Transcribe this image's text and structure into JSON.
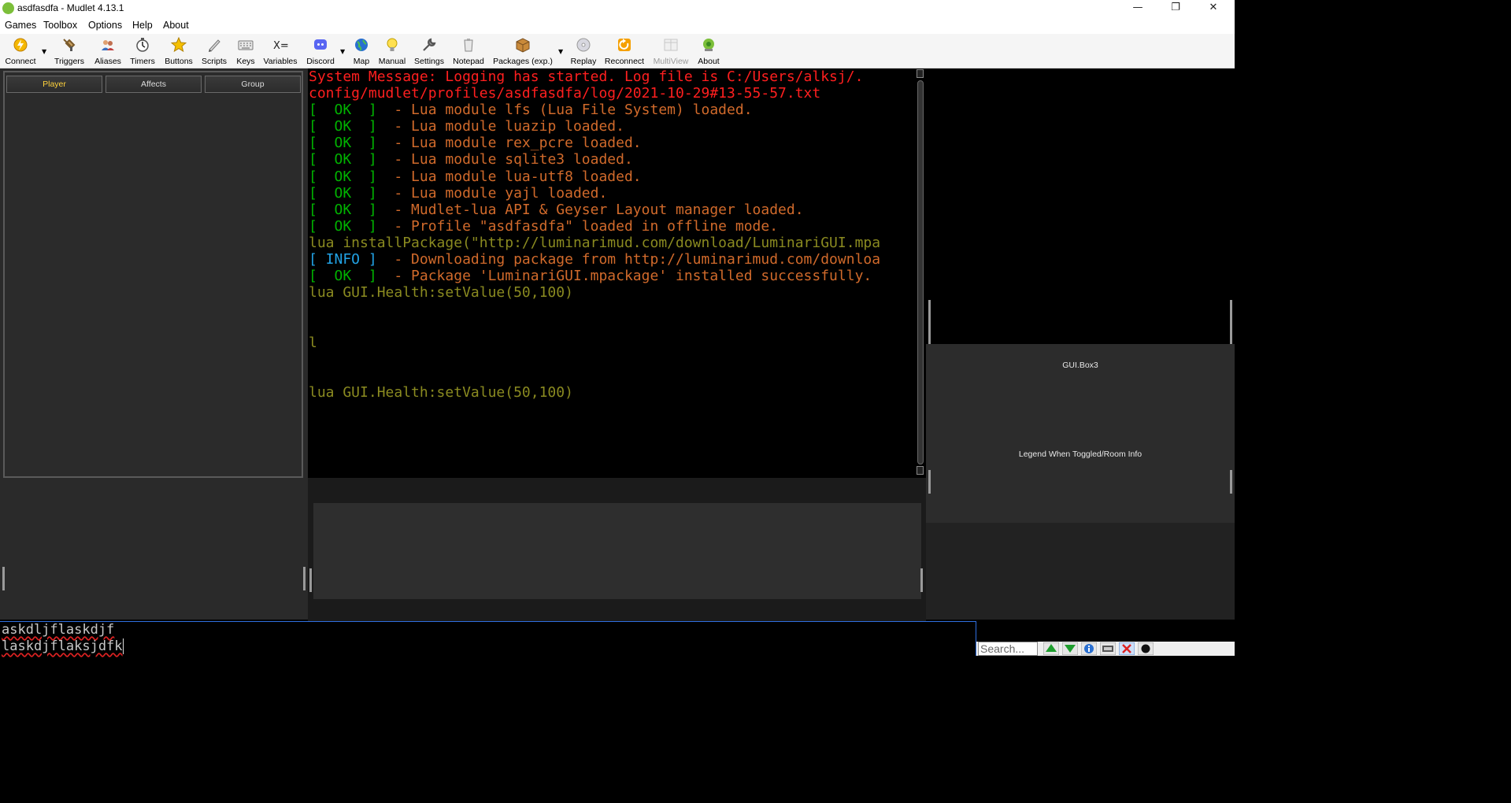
{
  "window": {
    "title": "asdfasdfa - Mudlet 4.13.1",
    "minimize_glyph": "—",
    "restore_glyph": "❐",
    "close_glyph": "✕"
  },
  "menu": [
    "Games",
    "Toolbox",
    "Options",
    "Help",
    "About"
  ],
  "toolbar": [
    {
      "label": "Connect",
      "icon": "connect-icon",
      "dropdown": true
    },
    {
      "label": "Triggers",
      "icon": "triggers-icon"
    },
    {
      "label": "Aliases",
      "icon": "aliases-icon"
    },
    {
      "label": "Timers",
      "icon": "timers-icon"
    },
    {
      "label": "Buttons",
      "icon": "buttons-icon"
    },
    {
      "label": "Scripts",
      "icon": "scripts-icon"
    },
    {
      "label": "Keys",
      "icon": "keys-icon"
    },
    {
      "label": "Variables",
      "icon": "variables-icon"
    },
    {
      "label": "Discord",
      "icon": "discord-icon",
      "dropdown": true
    },
    {
      "label": "Map",
      "icon": "map-icon"
    },
    {
      "label": "Manual",
      "icon": "manual-icon"
    },
    {
      "label": "Settings",
      "icon": "settings-icon"
    },
    {
      "label": "Notepad",
      "icon": "notepad-icon"
    },
    {
      "label": "Packages (exp.)",
      "icon": "packages-icon",
      "dropdown": true
    },
    {
      "label": "Replay",
      "icon": "replay-icon"
    },
    {
      "label": "Reconnect",
      "icon": "reconnect-icon"
    },
    {
      "label": "MultiView",
      "icon": "multiview-icon",
      "disabled": true
    },
    {
      "label": "About",
      "icon": "about-icon"
    }
  ],
  "left_tabs": [
    {
      "label": "Player",
      "active": true
    },
    {
      "label": "Affects",
      "active": false
    },
    {
      "label": "Group",
      "active": false
    }
  ],
  "console_lines": [
    [
      {
        "t": "System Message: Logging has started. Log file is C:/Users/alksj/.",
        "c": "red"
      }
    ],
    [
      {
        "t": "config/mudlet/profiles/asdfasdfa/log/2021-10-29#13-55-57.txt",
        "c": "red"
      }
    ],
    [
      {
        "t": "[  OK  ]",
        "c": "green"
      },
      {
        "t": "  - Lua module lfs (Lua File System) loaded.",
        "c": "orange"
      }
    ],
    [
      {
        "t": "[  OK  ]",
        "c": "green"
      },
      {
        "t": "  - Lua module luazip loaded.",
        "c": "orange"
      }
    ],
    [
      {
        "t": "[  OK  ]",
        "c": "green"
      },
      {
        "t": "  - Lua module rex_pcre loaded.",
        "c": "orange"
      }
    ],
    [
      {
        "t": "[  OK  ]",
        "c": "green"
      },
      {
        "t": "  - Lua module sqlite3 loaded.",
        "c": "orange"
      }
    ],
    [
      {
        "t": "[  OK  ]",
        "c": "green"
      },
      {
        "t": "  - Lua module lua-utf8 loaded.",
        "c": "orange"
      }
    ],
    [
      {
        "t": "[  OK  ]",
        "c": "green"
      },
      {
        "t": "  - Lua module yajl loaded.",
        "c": "orange"
      }
    ],
    [
      {
        "t": "[  OK  ]",
        "c": "green"
      },
      {
        "t": "  - Mudlet-lua API & Geyser Layout manager loaded.",
        "c": "orange"
      }
    ],
    [
      {
        "t": "[  OK  ]",
        "c": "green"
      },
      {
        "t": "  - Profile \"asdfasdfa\" loaded in offline mode.",
        "c": "orange"
      }
    ],
    [
      {
        "t": "lua installPackage(\"http://luminarimud.com/download/LuminariGUI.mpa",
        "c": "olive"
      }
    ],
    [
      {
        "t": "[ INFO ]",
        "c": "cyan"
      },
      {
        "t": "  - Downloading package from http://luminarimud.com/downloa",
        "c": "orange"
      }
    ],
    [
      {
        "t": "[  OK  ]",
        "c": "green"
      },
      {
        "t": "  - Package 'LuminariGUI.mpackage' installed successfully.",
        "c": "orange"
      }
    ],
    [
      {
        "t": "lua GUI.Health:setValue(50,100)",
        "c": "olive"
      }
    ],
    [
      {
        "t": "",
        "c": "olive"
      }
    ],
    [
      {
        "t": "",
        "c": "olive"
      }
    ],
    [
      {
        "t": "l",
        "c": "olive"
      }
    ],
    [
      {
        "t": "",
        "c": "olive"
      }
    ],
    [
      {
        "t": "",
        "c": "olive"
      }
    ],
    [
      {
        "t": "lua GUI.Health:setValue(50,100)",
        "c": "olive"
      }
    ]
  ],
  "right": {
    "box3_label": "GUI.Box3",
    "legend_label": "Legend When Toggled/Room Info"
  },
  "command_line": {
    "lines": [
      "askdljflaskdjf",
      "laskdjflaksjdfk"
    ]
  },
  "status_bar": {
    "search_placeholder": "Search...",
    "buttons": [
      "scroll-up-icon",
      "scroll-down-icon",
      "info-icon",
      "timestamp-icon",
      "log-icon",
      "record-icon"
    ]
  },
  "colors": {
    "red": "#ff1f1f",
    "orange": "#d16a2b",
    "green": "#00b300",
    "olive": "#8a8a20",
    "cyan": "#22a3e6",
    "accent_tab": "#ffd23c"
  }
}
